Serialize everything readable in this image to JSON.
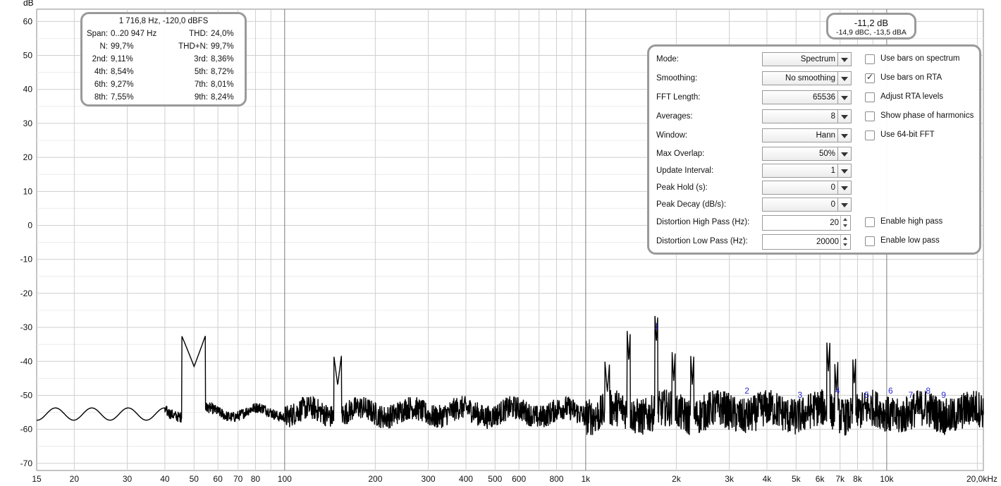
{
  "plot": {
    "y_unit": "dB",
    "y_ticks": [
      "60",
      "50",
      "40",
      "30",
      "20",
      "10",
      "0",
      "-10",
      "-20",
      "-30",
      "-40",
      "-50",
      "-60",
      "-70"
    ],
    "x_ticks": [
      "15",
      "20",
      "30",
      "40",
      "50",
      "60",
      "70",
      "80",
      "100",
      "200",
      "300",
      "400",
      "500",
      "600",
      "800",
      "1k",
      "2k",
      "3k",
      "4k",
      "5k",
      "6k",
      "7k",
      "8k",
      "10k",
      "20,0kHz"
    ],
    "harmonic_markers": [
      "1",
      "2",
      "3",
      "4",
      "5",
      "6",
      "7",
      "8",
      "9"
    ],
    "trace_color": "#000000",
    "marker_color": "#2a2ad8",
    "grid_color": "#cfcfcf",
    "major_grid_color": "#7a7a7a"
  },
  "distortion": {
    "header": "1 716,8 Hz, -120,0 dBFS",
    "span_label": "Span:",
    "span_value": "0..20 947 Hz",
    "thd_label": "THD:",
    "thd_value": "24,0%",
    "n_label": "N:",
    "n_value": "99,7%",
    "thdn_label": "THD+N:",
    "thdn_value": "99,7%",
    "h2_label": "2nd:",
    "h2_value": "9,11%",
    "h3_label": "3rd:",
    "h3_value": "8,36%",
    "h4_label": "4th:",
    "h4_value": "8,54%",
    "h5_label": "5th:",
    "h5_value": "8,72%",
    "h6_label": "6th:",
    "h6_value": "9,27%",
    "h7_label": "7th:",
    "h7_value": "8,01%",
    "h8_label": "8th:",
    "h8_value": "7,55%",
    "h9_label": "9th:",
    "h9_value": "8,24%"
  },
  "level": {
    "main": "-11,2 dB",
    "weighted": "-14,9 dBC, -13,5 dBA"
  },
  "settings": {
    "mode_label": "Mode:",
    "mode_value": "Spectrum",
    "smoothing_label": "Smoothing:",
    "smoothing_value": "No  smoothing",
    "fft_label": "FFT Length:",
    "fft_value": "65536",
    "averages_label": "Averages:",
    "averages_value": "8",
    "window_label": "Window:",
    "window_value": "Hann",
    "overlap_label": "Max Overlap:",
    "overlap_value": "50%",
    "update_label": "Update Interval:",
    "update_value": "1",
    "peakhold_label": "Peak Hold (s):",
    "peakhold_value": "0",
    "peakdecay_label": "Peak Decay (dB/s):",
    "peakdecay_value": "0",
    "hp_label": "Distortion High Pass (Hz):",
    "hp_value": "20",
    "lp_label": "Distortion Low Pass (Hz):",
    "lp_value": "20000",
    "cb_bars_spectrum": "Use bars on spectrum",
    "cb_bars_rta": "Use bars on RTA",
    "cb_adjust_rta": "Adjust RTA levels",
    "cb_phase": "Show phase of harmonics",
    "cb_64bit": "Use 64-bit FFT",
    "cb_highpass": "Enable high pass",
    "cb_lowpass": "Enable low pass"
  }
}
